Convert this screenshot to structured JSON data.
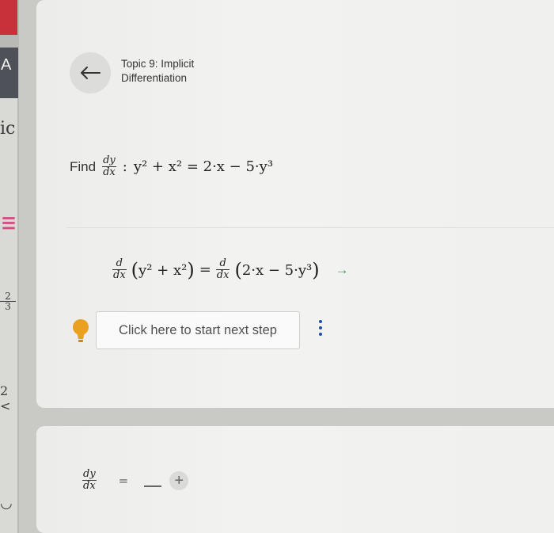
{
  "sidebar_fragments": {
    "top_text": "A",
    "ic_text": "ic",
    "fraction_num": "2",
    "fraction_den": "3",
    "two": "2"
  },
  "header": {
    "back_icon": "arrow-left-icon",
    "topic_title": "Topic 9: Implicit Differentiation"
  },
  "question": {
    "find_label": "Find",
    "derivative_num": "dy",
    "derivative_den": "dx",
    "separator": ":",
    "equation": "y² + x² = 2·x − 5·y³"
  },
  "step": {
    "d_num": "d",
    "d_den": "dx",
    "lhs_inner": "y² + x²",
    "equals": "=",
    "rhs_inner": "2·x − 5·y³",
    "arrow_icon": "arrow-right-icon"
  },
  "actions": {
    "hint_icon": "lightbulb-icon",
    "next_step_label": "Click here to start next step",
    "more_icon": "vertical-dots-icon"
  },
  "answer": {
    "lhs_num": "dy",
    "lhs_den": "dx",
    "equals": "=",
    "add_icon": "plus-icon",
    "add_label": "+"
  },
  "colors": {
    "accent_green": "#3a9a59",
    "kebab_blue": "#1e4fae",
    "hint_yellow": "#e9a11f"
  }
}
